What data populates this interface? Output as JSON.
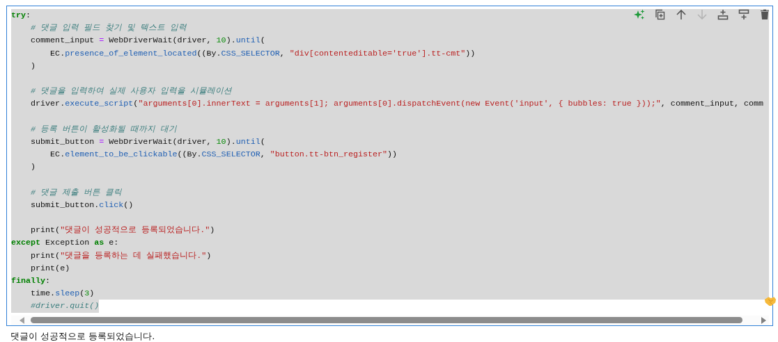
{
  "cell_toolbar": [
    {
      "disabled": false
    },
    {
      "disabled": false
    },
    {
      "disabled": false
    },
    {
      "disabled": true
    },
    {
      "disabled": false
    },
    {
      "disabled": false
    },
    {
      "disabled": false
    }
  ],
  "code": {
    "lines": [
      {
        "kind": "code",
        "tokens": [
          {
            "kind": "keyword",
            "text": "try"
          },
          {
            "kind": "plain",
            "text": ":"
          }
        ]
      },
      {
        "kind": "code",
        "tokens": [
          {
            "kind": "comment",
            "text": "    # 댓글 입력 필드 찾기 및 텍스트 입력"
          }
        ]
      },
      {
        "kind": "code",
        "tokens": [
          {
            "kind": "plain",
            "text": "    comment_input "
          },
          {
            "kind": "operator",
            "text": "="
          },
          {
            "kind": "plain",
            "text": " WebDriverWait(driver, "
          },
          {
            "kind": "number",
            "text": "10"
          },
          {
            "kind": "plain",
            "text": ")."
          },
          {
            "kind": "name",
            "text": "until"
          },
          {
            "kind": "plain",
            "text": "("
          }
        ]
      },
      {
        "kind": "code",
        "tokens": [
          {
            "kind": "plain",
            "text": "        EC."
          },
          {
            "kind": "name",
            "text": "presence_of_element_located"
          },
          {
            "kind": "plain",
            "text": "((By."
          },
          {
            "kind": "name",
            "text": "CSS_SELECTOR"
          },
          {
            "kind": "plain",
            "text": ", "
          },
          {
            "kind": "string",
            "text": "\"div[contenteditable='true'].tt-cmt\""
          },
          {
            "kind": "plain",
            "text": "))"
          }
        ]
      },
      {
        "kind": "code",
        "tokens": [
          {
            "kind": "plain",
            "text": "    )"
          }
        ]
      },
      {
        "kind": "blank"
      },
      {
        "kind": "code",
        "tokens": [
          {
            "kind": "comment",
            "text": "    # 댓글을 입력하여 실제 사용자 입력을 시뮬레이션"
          }
        ]
      },
      {
        "kind": "code",
        "tokens": [
          {
            "kind": "plain",
            "text": "    driver."
          },
          {
            "kind": "name",
            "text": "execute_script"
          },
          {
            "kind": "plain",
            "text": "("
          },
          {
            "kind": "string",
            "text": "\"arguments[0].innerText = arguments[1]; arguments[0].dispatchEvent(new Event('input', { bubbles: true }));\""
          },
          {
            "kind": "plain",
            "text": ", comment_input, comm"
          }
        ]
      },
      {
        "kind": "blank"
      },
      {
        "kind": "code",
        "tokens": [
          {
            "kind": "comment",
            "text": "    # 등록 버튼이 활성화될 때까지 대기"
          }
        ]
      },
      {
        "kind": "code",
        "tokens": [
          {
            "kind": "plain",
            "text": "    submit_button "
          },
          {
            "kind": "operator",
            "text": "="
          },
          {
            "kind": "plain",
            "text": " WebDriverWait(driver, "
          },
          {
            "kind": "number",
            "text": "10"
          },
          {
            "kind": "plain",
            "text": ")."
          },
          {
            "kind": "name",
            "text": "until"
          },
          {
            "kind": "plain",
            "text": "("
          }
        ]
      },
      {
        "kind": "code",
        "tokens": [
          {
            "kind": "plain",
            "text": "        EC."
          },
          {
            "kind": "name",
            "text": "element_to_be_clickable"
          },
          {
            "kind": "plain",
            "text": "((By."
          },
          {
            "kind": "name",
            "text": "CSS_SELECTOR"
          },
          {
            "kind": "plain",
            "text": ", "
          },
          {
            "kind": "string",
            "text": "\"button.tt-btn_register\""
          },
          {
            "kind": "plain",
            "text": "))"
          }
        ]
      },
      {
        "kind": "code",
        "tokens": [
          {
            "kind": "plain",
            "text": "    )"
          }
        ]
      },
      {
        "kind": "blank"
      },
      {
        "kind": "code",
        "tokens": [
          {
            "kind": "comment",
            "text": "    # 댓글 제출 버튼 클릭"
          }
        ]
      },
      {
        "kind": "code",
        "tokens": [
          {
            "kind": "plain",
            "text": "    submit_button."
          },
          {
            "kind": "name",
            "text": "click"
          },
          {
            "kind": "plain",
            "text": "()"
          }
        ]
      },
      {
        "kind": "blank"
      },
      {
        "kind": "code",
        "tokens": [
          {
            "kind": "plain",
            "text": "    print("
          },
          {
            "kind": "string",
            "text": "\"댓글이 성공적으로 등록되었습니다.\""
          },
          {
            "kind": "plain",
            "text": ")"
          }
        ]
      },
      {
        "kind": "code",
        "tokens": [
          {
            "kind": "keyword",
            "text": "except"
          },
          {
            "kind": "plain",
            "text": " Exception "
          },
          {
            "kind": "keyword",
            "text": "as"
          },
          {
            "kind": "plain",
            "text": " e:"
          }
        ]
      },
      {
        "kind": "code",
        "tokens": [
          {
            "kind": "plain",
            "text": "    print("
          },
          {
            "kind": "string",
            "text": "\"댓글을 등록하는 데 실패했습니다.\""
          },
          {
            "kind": "plain",
            "text": ")"
          }
        ]
      },
      {
        "kind": "code",
        "tokens": [
          {
            "kind": "plain",
            "text": "    print(e)"
          }
        ]
      },
      {
        "kind": "code",
        "tokens": [
          {
            "kind": "keyword",
            "text": "finally"
          },
          {
            "kind": "plain",
            "text": ":"
          }
        ]
      },
      {
        "kind": "code",
        "tokens": [
          {
            "kind": "plain",
            "text": "    time."
          },
          {
            "kind": "name",
            "text": "sleep"
          },
          {
            "kind": "plain",
            "text": "("
          },
          {
            "kind": "number",
            "text": "3"
          },
          {
            "kind": "plain",
            "text": ")"
          }
        ]
      },
      {
        "kind": "code",
        "tokens": [
          {
            "kind": "comment",
            "text": "    #driver.quit()"
          }
        ]
      }
    ]
  },
  "output": "댓글이 성공적으로 등록되었습니다."
}
